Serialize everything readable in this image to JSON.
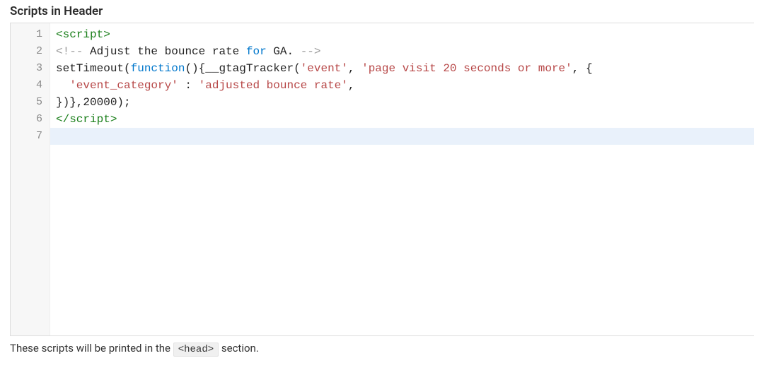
{
  "section": {
    "title": "Scripts in Header"
  },
  "editor": {
    "lines": [
      {
        "n": 1,
        "tokens": [
          {
            "cls": "tok-tag",
            "t": "<script>"
          }
        ]
      },
      {
        "n": 2,
        "tokens": [
          {
            "cls": "tok-comment",
            "t": "<!-- "
          },
          {
            "cls": "tok-plain",
            "t": "Adjust the bounce rate "
          },
          {
            "cls": "tok-kw",
            "t": "for"
          },
          {
            "cls": "tok-plain",
            "t": " GA. "
          },
          {
            "cls": "tok-comment",
            "t": "-->"
          }
        ]
      },
      {
        "n": 3,
        "tokens": [
          {
            "cls": "tok-plain",
            "t": "setTimeout("
          },
          {
            "cls": "tok-kw",
            "t": "function"
          },
          {
            "cls": "tok-plain",
            "t": "(){__gtagTracker("
          },
          {
            "cls": "tok-str",
            "t": "'event'"
          },
          {
            "cls": "tok-plain",
            "t": ", "
          },
          {
            "cls": "tok-str",
            "t": "'page visit 20 seconds or more'"
          },
          {
            "cls": "tok-plain",
            "t": ", {"
          }
        ]
      },
      {
        "n": 4,
        "tokens": [
          {
            "cls": "tok-plain",
            "t": "  "
          },
          {
            "cls": "tok-str",
            "t": "'event_category'"
          },
          {
            "cls": "tok-plain",
            "t": " : "
          },
          {
            "cls": "tok-str",
            "t": "'adjusted bounce rate'"
          },
          {
            "cls": "tok-plain",
            "t": ","
          }
        ]
      },
      {
        "n": 5,
        "tokens": [
          {
            "cls": "tok-plain",
            "t": "})},20000);"
          }
        ]
      },
      {
        "n": 6,
        "tokens": [
          {
            "cls": "tok-tag",
            "t": "</"
          },
          {
            "cls": "tok-tag",
            "t": "script>"
          }
        ]
      },
      {
        "n": 7,
        "tokens": [
          {
            "cls": "tok-plain",
            "t": ""
          }
        ],
        "active": true
      }
    ]
  },
  "help": {
    "before": "These scripts will be printed in the ",
    "code": "<head>",
    "after": " section."
  }
}
